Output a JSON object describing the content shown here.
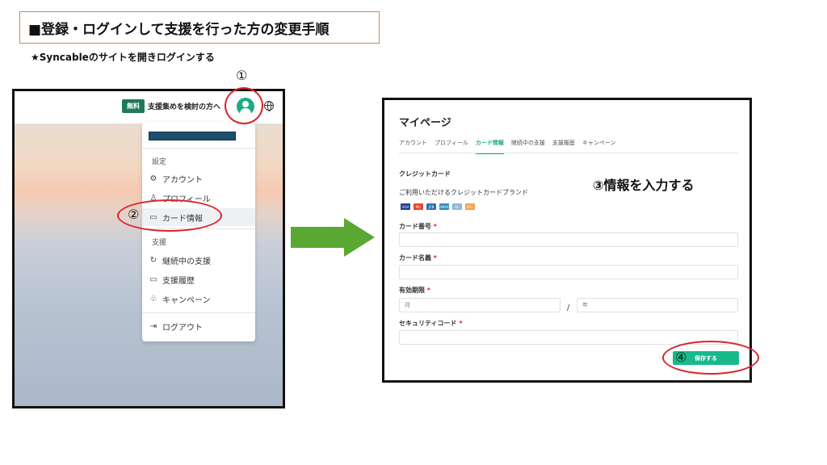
{
  "header": {
    "title": "■登録・ログインして支援を行った方の変更手順",
    "subtitle": "★Syncableのサイトを開きログインする"
  },
  "steps": {
    "one": "①",
    "two": "②",
    "three": "③情報を入力する",
    "four": "④"
  },
  "left_screen": {
    "badge": "無料",
    "topbar_link": "支援集めを検討の方へ",
    "menu": {
      "section_settings": "設定",
      "account": "アカウント",
      "profile": "プロフィール",
      "card_info": "カード情報",
      "section_support": "支援",
      "continuing": "継続中の支援",
      "history": "支援履歴",
      "campaign": "キャンペーン",
      "logout": "ログアウト"
    }
  },
  "right_screen": {
    "title": "マイページ",
    "tabs": [
      "アカウント",
      "プロフィール",
      "カード情報",
      "継続中の支援",
      "支援履歴",
      "キャンペーン"
    ],
    "active_tab": 2,
    "credit_card_heading": "クレジットカード",
    "brands_text": "ご利用いただけるクレジットカードブランド",
    "brands": [
      "VISA",
      "MC",
      "JCB",
      "AMEX",
      "DC",
      "DSC"
    ],
    "fields": {
      "card_number": "カード番号",
      "card_name": "カード名義",
      "expiry": "有効期限",
      "security_code": "セキュリティコード",
      "required_mark": "*",
      "month_placeholder": "月",
      "year_placeholder": "年",
      "slash": "/"
    },
    "save_label": "保存する"
  },
  "colors": {
    "accent": "#1fa987",
    "annotation_red": "#d9232d",
    "arrow_green": "#5aa832",
    "username_bar": "#1d4f6f"
  }
}
